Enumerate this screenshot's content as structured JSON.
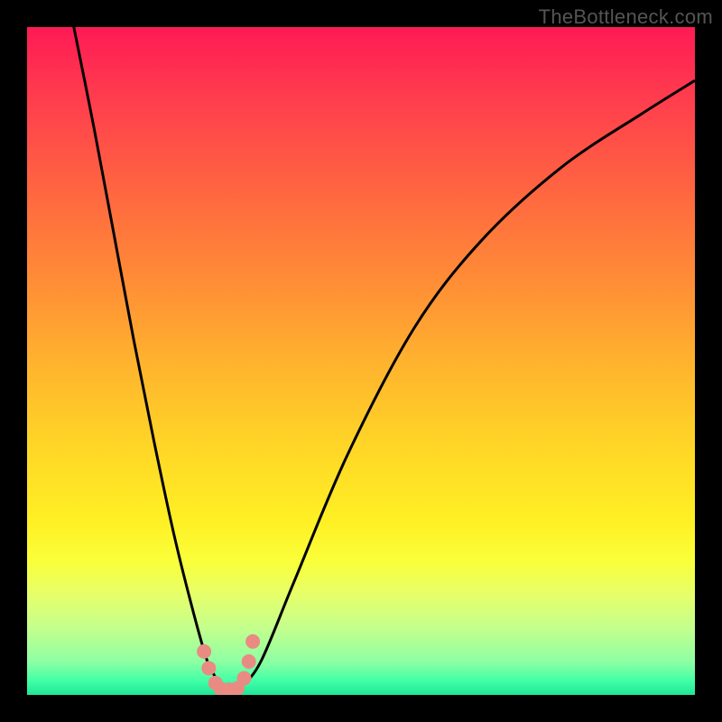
{
  "watermark": "TheBottleneck.com",
  "chart_data": {
    "type": "line",
    "title": "",
    "xlabel": "",
    "ylabel": "",
    "xlim": [
      0,
      100
    ],
    "ylim": [
      0,
      100
    ],
    "grid": false,
    "legend": false,
    "series": [
      {
        "name": "curve",
        "x": [
          7,
          10,
          13,
          16,
          19,
          22,
          25,
          27,
          28,
          29,
          30,
          31,
          32,
          35,
          40,
          48,
          58,
          68,
          80,
          92,
          100
        ],
        "y": [
          100,
          85,
          69,
          53,
          38,
          24,
          12,
          5,
          3,
          1.2,
          0.8,
          0.8,
          1.2,
          5,
          17,
          36,
          55,
          68,
          79,
          87,
          92
        ]
      }
    ],
    "markers": {
      "name": "highlight-points",
      "x": [
        26.5,
        27.2,
        28.2,
        29.0,
        30.2,
        31.5,
        32.5,
        33.2,
        33.8
      ],
      "y": [
        6.5,
        4.0,
        1.8,
        0.9,
        0.8,
        1.0,
        2.5,
        5.0,
        8.0
      ]
    },
    "background_gradient": {
      "top_color": "#ff1a55",
      "mid_color": "#ffd427",
      "bottom_color": "#20e596"
    }
  }
}
